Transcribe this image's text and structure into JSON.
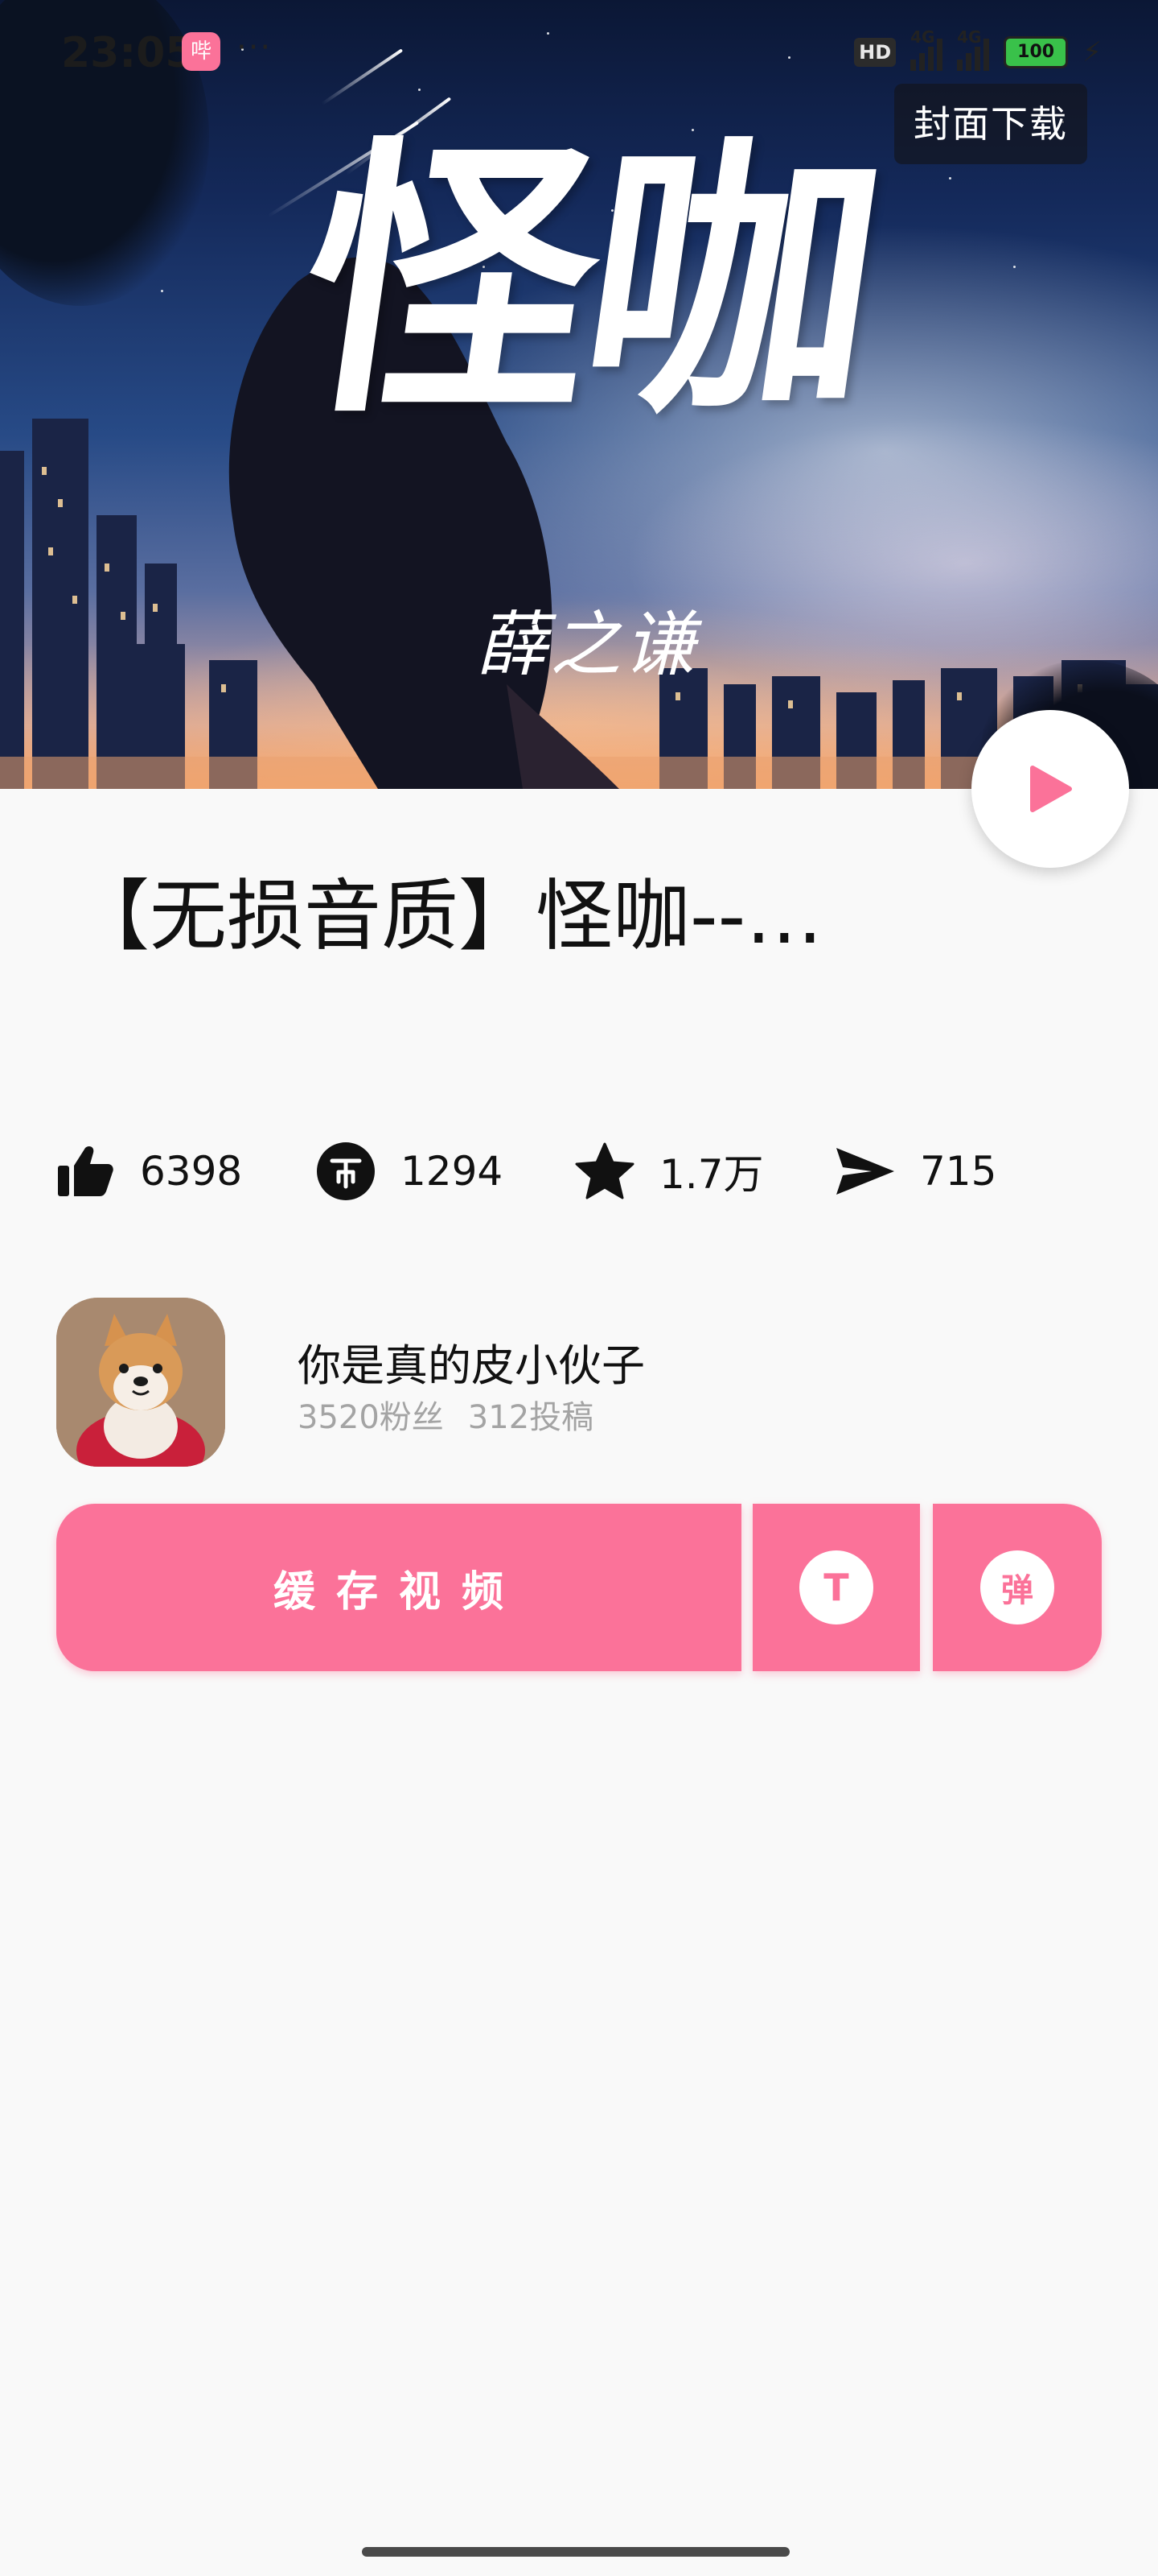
{
  "status_bar": {
    "time": "23:05",
    "app_badge": "哔",
    "more": "···",
    "hd": "HD",
    "network_1": "4G",
    "network_2": "4G",
    "battery": "100",
    "charging_icon": "bolt-icon"
  },
  "cover": {
    "title": "怪咖",
    "subtitle": "薛之谦",
    "download_label": "封面下载"
  },
  "video": {
    "title": "【无损音质】怪咖--…"
  },
  "stats": {
    "likes": "6398",
    "coins": "1294",
    "favorites": "1.7万",
    "shares": "715"
  },
  "uploader": {
    "name": "你是真的皮小伙子",
    "fans": "3520粉丝",
    "posts": "312投稿"
  },
  "actions": {
    "cache_label": "缓存视频",
    "coin_icon": "T",
    "danmaku_label": "弹"
  },
  "colors": {
    "accent": "#fb7299",
    "background": "#f9f9f9"
  }
}
